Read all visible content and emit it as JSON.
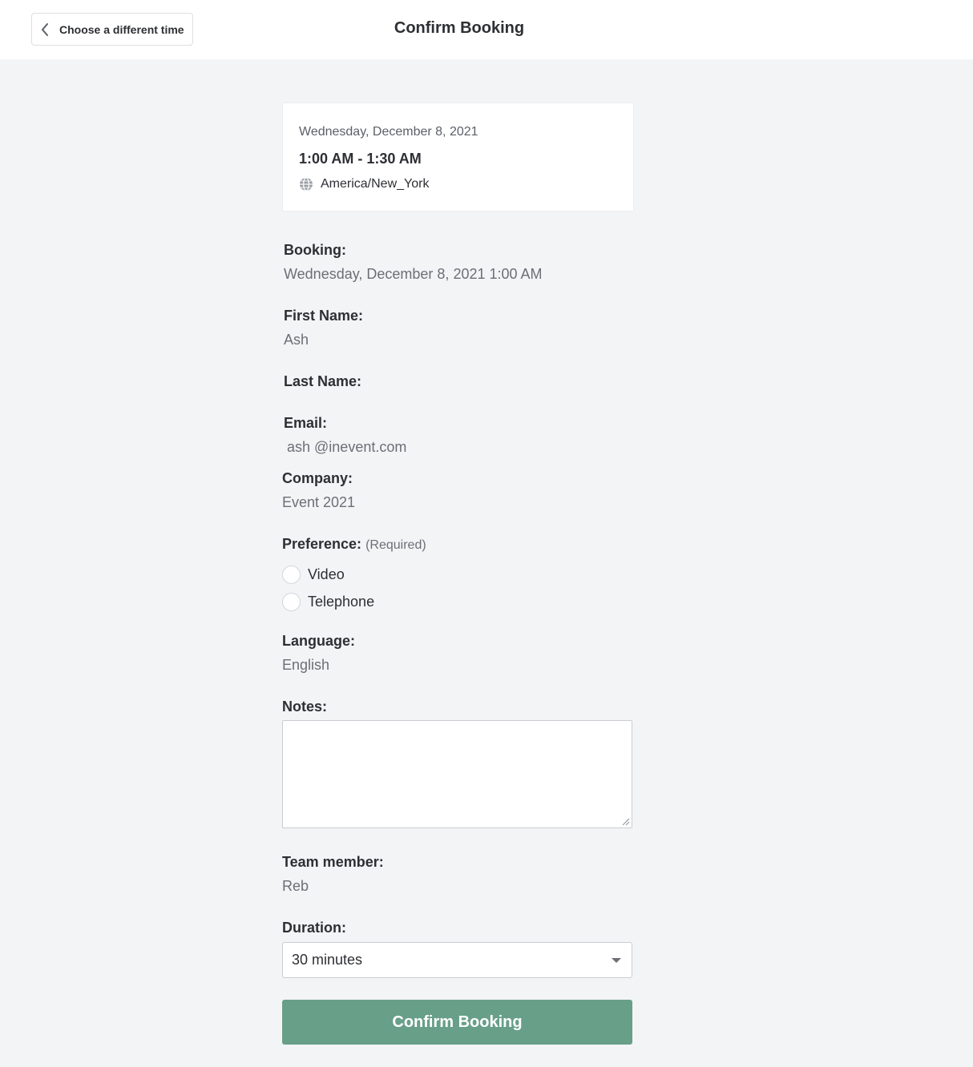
{
  "header": {
    "back_label": "Choose a different time",
    "title": "Confirm Booking"
  },
  "slot": {
    "date": "Wednesday, December 8, 2021",
    "time": "1:00 AM - 1:30 AM",
    "timezone": "America/New_York",
    "timezone_icon": "globe-icon"
  },
  "form": {
    "booking": {
      "label": "Booking:",
      "value": "Wednesday, December 8, 2021 1:00 AM"
    },
    "first_name": {
      "label": "First Name:",
      "value": "Ash"
    },
    "last_name": {
      "label": "Last Name:",
      "value": ""
    },
    "email": {
      "label": "Email:",
      "value": "ash @inevent.com"
    },
    "company": {
      "label": "Company:",
      "value": "Event 2021"
    },
    "preference": {
      "label": "Preference:",
      "required": "(Required)",
      "options": [
        "Video",
        "Telephone"
      ]
    },
    "language": {
      "label": "Language:",
      "value": "English"
    },
    "notes": {
      "label": "Notes:",
      "value": ""
    },
    "team_member": {
      "label": "Team member:",
      "value": "Reb"
    },
    "duration": {
      "label": "Duration:",
      "value": "30 minutes"
    },
    "submit_label": "Confirm Booking"
  },
  "colors": {
    "accent": "#689f89",
    "background": "#f3f4f6"
  }
}
